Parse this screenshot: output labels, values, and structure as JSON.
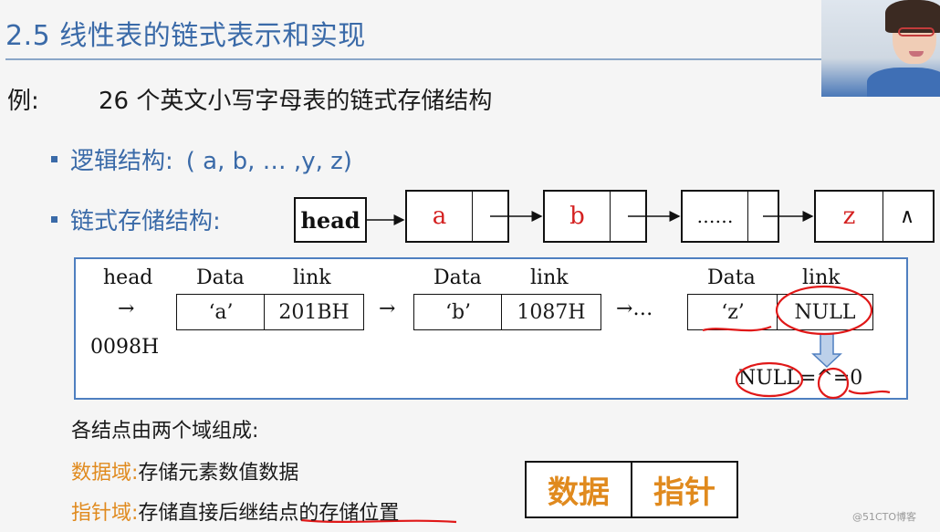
{
  "slide": {
    "title": "2.5 线性表的链式表示和实现",
    "example_label": "例:",
    "example_text": "26 个英文小写字母表的链式存储结构"
  },
  "bullets": [
    {
      "label": "逻辑结构:",
      "value": "( a, b, … ,y, z)"
    },
    {
      "label": "链式存储结构:"
    }
  ],
  "linked_list": {
    "head_label": "head",
    "nodes": [
      {
        "data": "a",
        "link": ""
      },
      {
        "data": "b",
        "link": ""
      },
      {
        "data": "……",
        "link": ""
      },
      {
        "data": "z",
        "link": "∧"
      }
    ]
  },
  "memory_view": {
    "head_label": "head",
    "head_arrow": "→",
    "head_address": "0098H",
    "column_data": "Data",
    "column_link": "link",
    "nodes": [
      {
        "data": "‘a’",
        "link": "201BH"
      },
      {
        "data": "‘b’",
        "link": "1087H"
      },
      {
        "data": "‘z’",
        "link": "NULL"
      }
    ],
    "arrow": "→",
    "ellipsis_arrow": "→…",
    "null_equation": "NULL=^=0"
  },
  "description": {
    "intro": "各结点由两个域组成:",
    "fields": [
      {
        "key": "数据域:",
        "value": "存储元素数值数据"
      },
      {
        "key": "指针域:",
        "value": "存储直接后继结点的存储位置"
      }
    ]
  },
  "field_legend": [
    "数据",
    "指针"
  ],
  "colors": {
    "title_blue": "#3a6aa8",
    "data_red": "#d42020",
    "field_orange": "#e08a1e",
    "panel_border": "#4f7fc0",
    "annotation_red": "#e01818"
  },
  "watermark": "@51CTO博客"
}
